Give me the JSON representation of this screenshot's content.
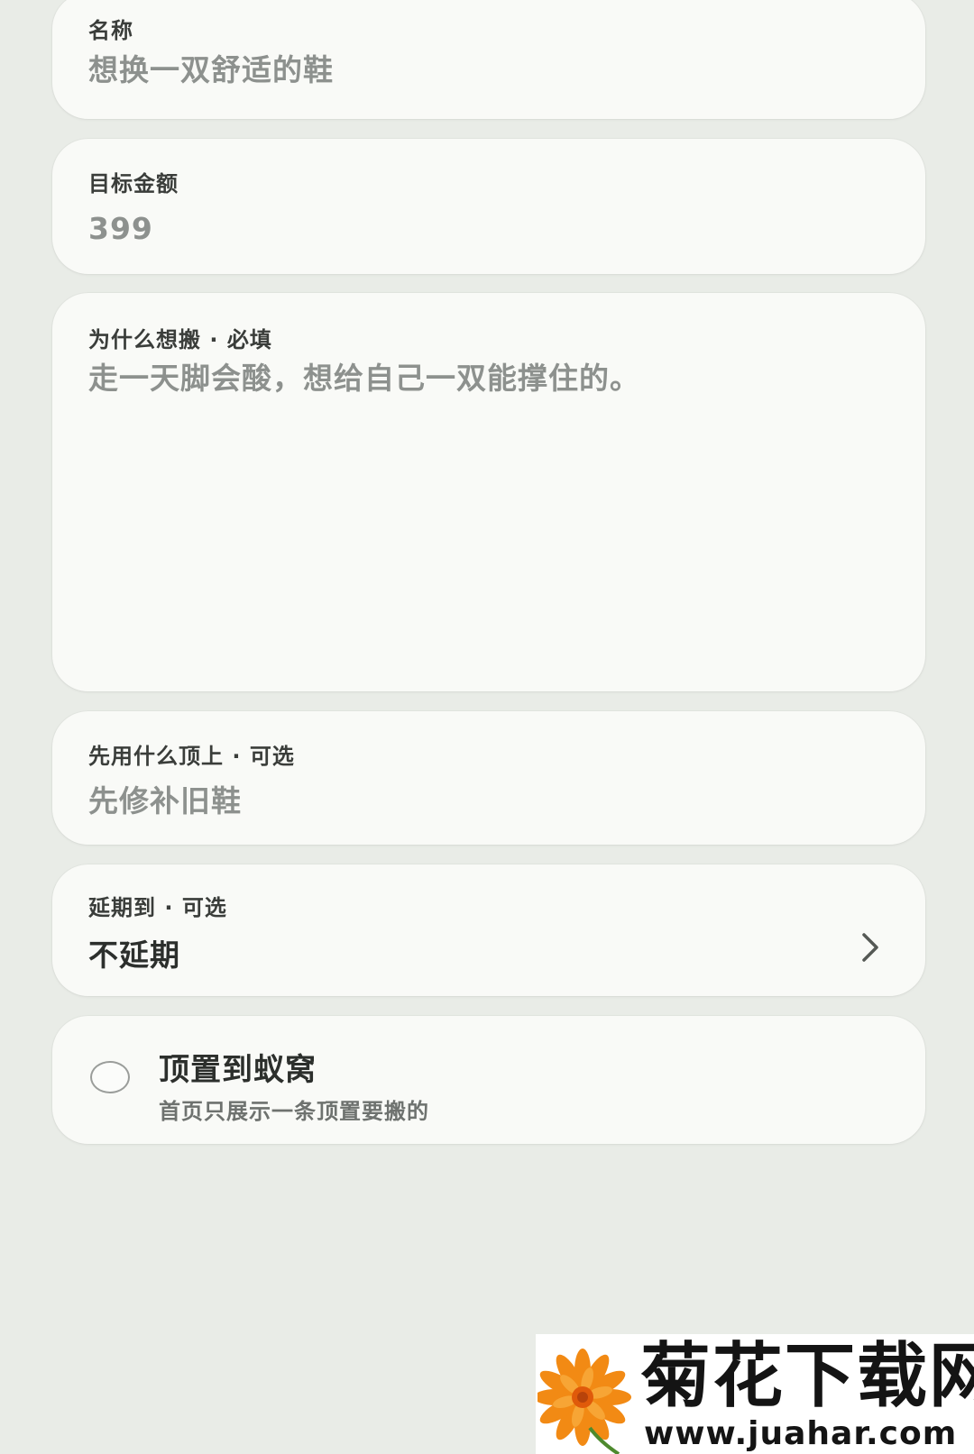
{
  "form": {
    "name": {
      "label": "名称",
      "value": "想换一双舒适的鞋"
    },
    "target_amount": {
      "label": "目标金额",
      "value": "399"
    },
    "reason": {
      "label": "为什么想搬 · 必填",
      "value": "走一天脚会酸，想给自己一双能撑住的。"
    },
    "stopgap": {
      "label": "先用什么顶上 · 可选",
      "value": "先修补旧鞋"
    },
    "postpone": {
      "label": "延期到 · 可选",
      "value": "不延期",
      "icon": "chevron-right-icon"
    },
    "pin": {
      "title": "顶置到蚁窝",
      "subtitle": "首页只展示一条顶置要搬的",
      "checked": false
    }
  },
  "watermark": {
    "title": "菊花下载网",
    "url": "www.juahar.com",
    "icon": "chrysanthemum-logo",
    "colors": {
      "petal": "#f28a14",
      "center": "#e05a0a"
    }
  },
  "colors": {
    "background": "#e9ece7",
    "card": "#f9faf7",
    "label": "#3a3d3a",
    "placeholder_value": "#8d918e",
    "strong_text": "#2c2f2c"
  }
}
